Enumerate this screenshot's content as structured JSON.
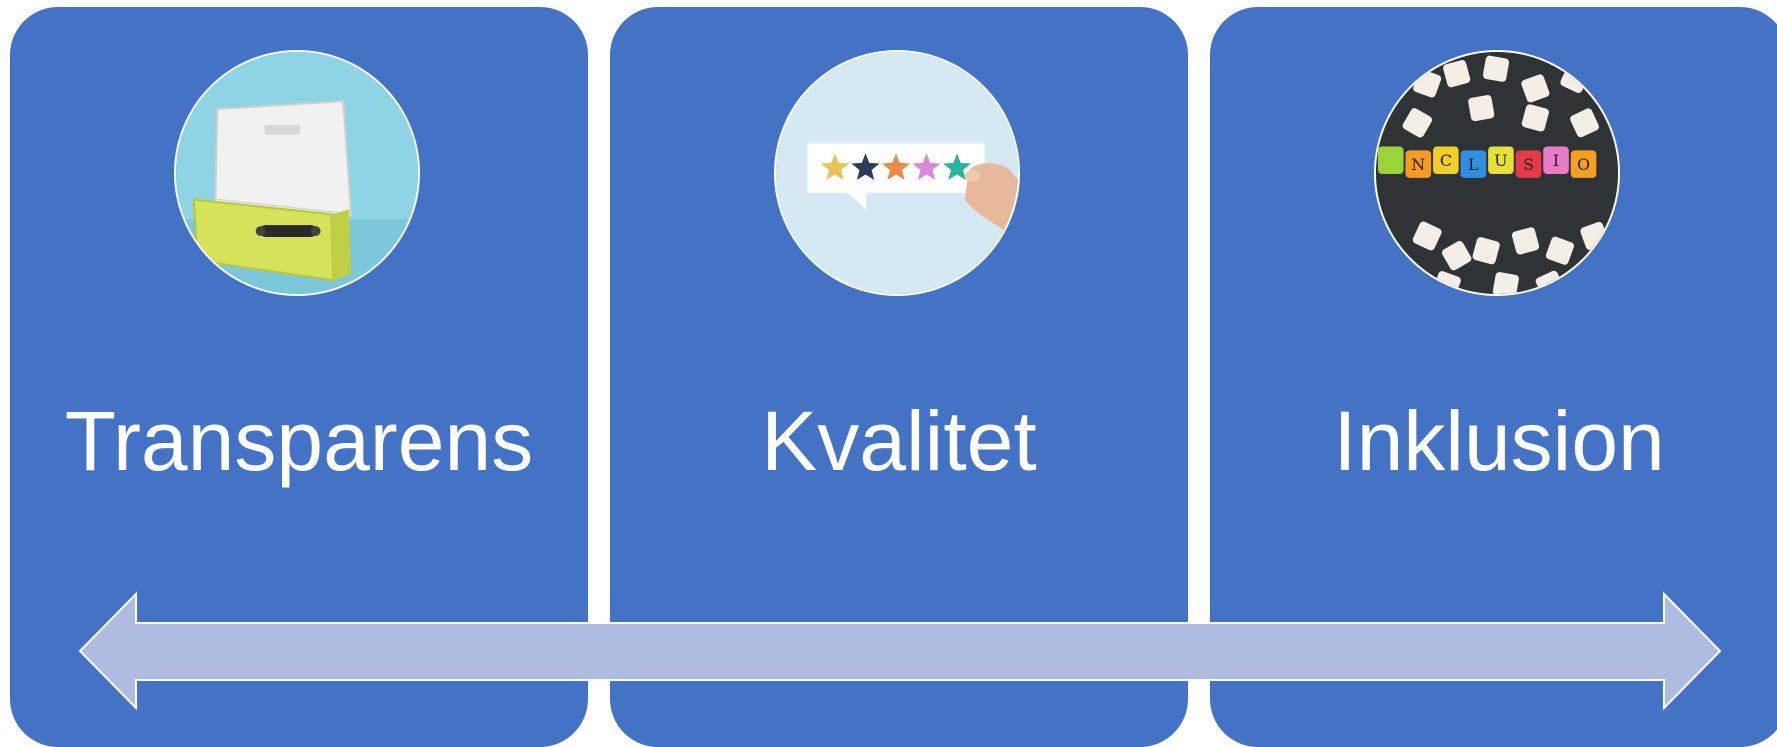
{
  "cards": [
    {
      "label": "Transparens",
      "image": "open-suitcase-photo"
    },
    {
      "label": "Kvalitet",
      "image": "star-rating-photo"
    },
    {
      "label": "Inklusion",
      "image": "letter-cubes-photo"
    }
  ],
  "inclusion_letters": [
    "N",
    "C",
    "L",
    "U",
    "S",
    "I",
    "O"
  ],
  "colors": {
    "card": "#4472c4",
    "arrow_fill": "#aebadf",
    "arrow_stroke": "#ffffff",
    "text": "#ffffff"
  }
}
